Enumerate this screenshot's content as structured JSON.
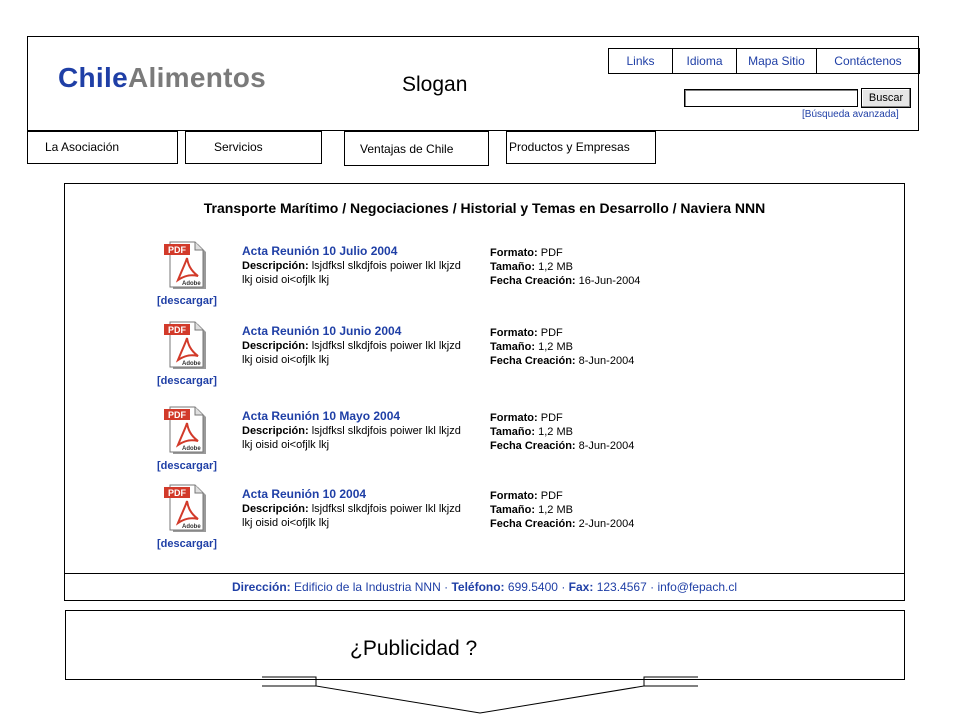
{
  "header": {
    "logo_part1": "Chile",
    "logo_part2": "Alimentos",
    "slogan": "Slogan"
  },
  "top_links": [
    "Links",
    "Idioma",
    "Mapa Sitio",
    "Contáctenos"
  ],
  "search": {
    "button_label": "Buscar",
    "advanced_label": "[Búsqueda avanzada]"
  },
  "nav": {
    "tabs": [
      "La Asociación",
      "Servicios",
      "Ventajas de Chile",
      "Productos y Empresas"
    ]
  },
  "main": {
    "title": "Transporte Marítimo / Negociaciones / Historial y Temas en Desarrollo / Naviera NNN",
    "documents": [
      {
        "title": "Acta Reunión 10 Julio 2004",
        "desc_label": "Descripción:",
        "desc_text": "lsjdfksl slkdjfois poiwer lkl lkjzd lkj oisid oi<ofjlk lkj",
        "format_label": "Formato:",
        "format_value": "PDF",
        "size_label": "Tamaño:",
        "size_value": "1,2 MB",
        "date_label": "Fecha Creación:",
        "date_value": "16-Jun-2004",
        "download_label": "[descargar]"
      },
      {
        "title": "Acta Reunión 10 Junio 2004",
        "desc_label": "Descripción:",
        "desc_text": "lsjdfksl slkdjfois poiwer lkl lkjzd lkj oisid oi<ofjlk lkj",
        "format_label": "Formato:",
        "format_value": "PDF",
        "size_label": "Tamaño:",
        "size_value": "1,2 MB",
        "date_label": "Fecha Creación:",
        "date_value": "8-Jun-2004",
        "download_label": "[descargar]"
      },
      {
        "title": "Acta Reunión 10 Mayo 2004",
        "desc_label": "Descripción:",
        "desc_text": "lsjdfksl slkdjfois poiwer lkl lkjzd lkj oisid oi<ofjlk lkj",
        "format_label": "Formato:",
        "format_value": "PDF",
        "size_label": "Tamaño:",
        "size_value": "1,2 MB",
        "date_label": "Fecha Creación:",
        "date_value": "8-Jun-2004",
        "download_label": "[descargar]"
      },
      {
        "title": "Acta Reunión 10 2004",
        "desc_label": "Descripción:",
        "desc_text": "lsjdfksl slkdjfois poiwer lkl lkjzd lkj oisid oi<ofjlk lkj",
        "format_label": "Formato:",
        "format_value": "PDF",
        "size_label": "Tamaño:",
        "size_value": "1,2 MB",
        "date_label": "Fecha Creación:",
        "date_value": "2-Jun-2004",
        "download_label": "[descargar]"
      }
    ],
    "pdf_icon_text": "PDF",
    "pdf_icon_brand": "Adobe"
  },
  "footer": {
    "address_label": "Dirección:",
    "address_value": "Edificio de la Industria NNN",
    "phone_label": "Teléfono:",
    "phone_value": "699.5400",
    "fax_label": "Fax:",
    "fax_value": "123.4567",
    "email": "info@fepach.cl",
    "separator": "·"
  },
  "ad": {
    "text": "¿Publicidad ?"
  },
  "colors": {
    "link_blue": "#1f3fa6",
    "logo_gray": "#7a7a7a",
    "pdf_red": "#d23a2a"
  }
}
